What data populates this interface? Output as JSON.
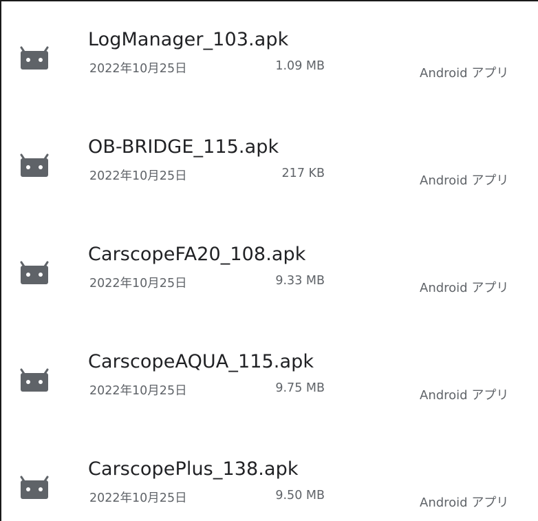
{
  "files": [
    {
      "name": "LogManager_103.apk",
      "date": "2022年10月25日",
      "size": "1.09 MB",
      "type": "Android アプリ",
      "icon": "android-icon"
    },
    {
      "name": "OB-BRIDGE_115.apk",
      "date": "2022年10月25日",
      "size": "217 KB",
      "type": "Android アプリ",
      "icon": "android-icon"
    },
    {
      "name": "CarscopeFA20_108.apk",
      "date": "2022年10月25日",
      "size": "9.33 MB",
      "type": "Android アプリ",
      "icon": "android-icon"
    },
    {
      "name": "CarscopeAQUA_115.apk",
      "date": "2022年10月25日",
      "size": "9.75 MB",
      "type": "Android アプリ",
      "icon": "android-icon"
    },
    {
      "name": "CarscopePlus_138.apk",
      "date": "2022年10月25日",
      "size": "9.50 MB",
      "type": "Android アプリ",
      "icon": "android-icon"
    }
  ],
  "colors": {
    "icon": "#5f6368",
    "title": "#202124",
    "meta": "#5f6368",
    "background": "#ffffff"
  }
}
